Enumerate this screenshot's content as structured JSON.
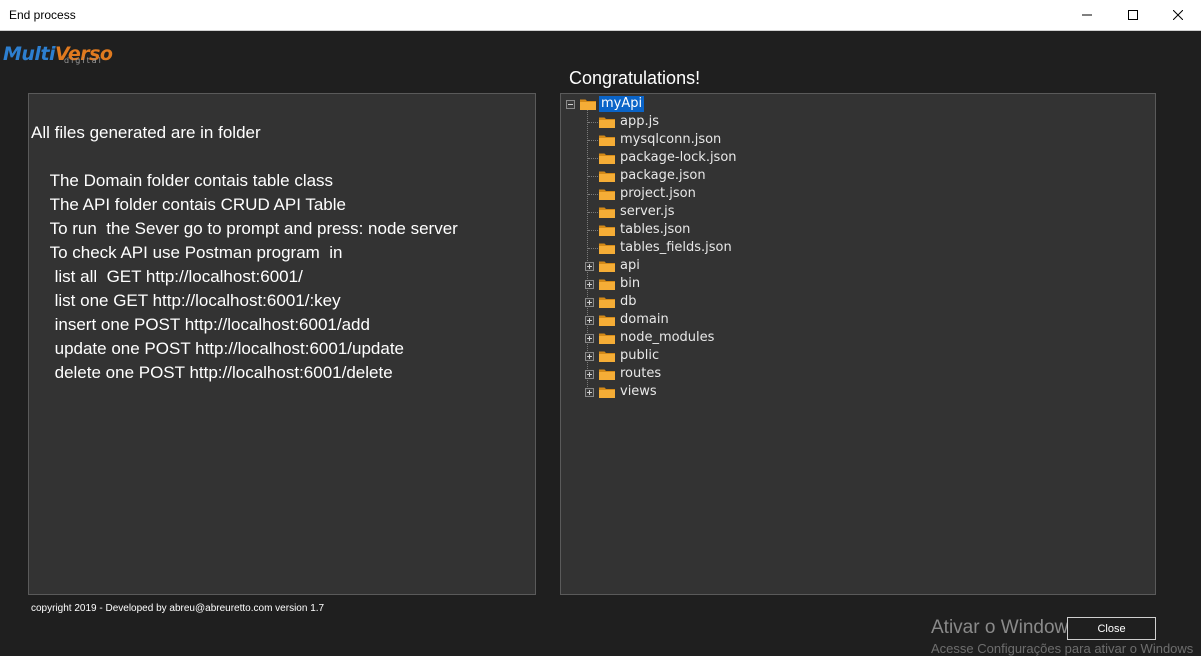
{
  "window": {
    "title": "End process"
  },
  "logo": {
    "part1": "Multi",
    "part2": "Verso",
    "sub": "digital"
  },
  "heading": "Congratulations!",
  "info_lines": [
    "All files generated are in folder",
    "    The Domain folder contais table class",
    "    The API folder contais CRUD API Table",
    "    To run  the Sever go to prompt and press: node server",
    "    To check API use Postman program  in",
    "     list all  GET http://localhost:6001/",
    "     list one GET http://localhost:6001/:key",
    "     insert one POST http://localhost:6001/add",
    "     update one POST http://localhost:6001/update",
    "     delete one POST http://localhost:6001/delete"
  ],
  "tree": {
    "root": "myApi",
    "files": [
      "app.js",
      "mysqlconn.json",
      "package-lock.json",
      "package.json",
      "project.json",
      "server.js",
      "tables.json",
      "tables_fields.json"
    ],
    "folders": [
      "api",
      "bin",
      "db",
      "domain",
      "node_modules",
      "public",
      "routes",
      "views"
    ]
  },
  "footer": "copyright 2019 - Developed by abreu@abreuretto.com  version 1.7",
  "watermark": {
    "line1": "Ativar o Windows",
    "line2": "Acesse Configurações para ativar o Windows"
  },
  "close_label": "Close",
  "colors": {
    "selection": "#0a64c8",
    "folder": "#f0a530"
  },
  "icons": {
    "minimize": "minimize-icon",
    "maximize": "maximize-icon",
    "close": "close-icon",
    "folder": "folder-icon"
  }
}
